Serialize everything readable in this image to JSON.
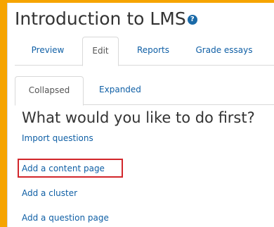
{
  "page": {
    "title": "Introduction to LMS",
    "help_icon": "question-circle-icon"
  },
  "primary_tabs": [
    "Preview",
    "Edit",
    "Reports",
    "Grade essays"
  ],
  "secondary_tabs": [
    "Collapsed",
    "Expanded"
  ],
  "main": {
    "heading": "What would you like to do first?",
    "actions": [
      "Import questions",
      "Add a content page",
      "Add a cluster",
      "Add a question page"
    ]
  },
  "colors": {
    "background": "#f6a400",
    "link": "#0f5fa5",
    "highlight": "#d2262b"
  }
}
